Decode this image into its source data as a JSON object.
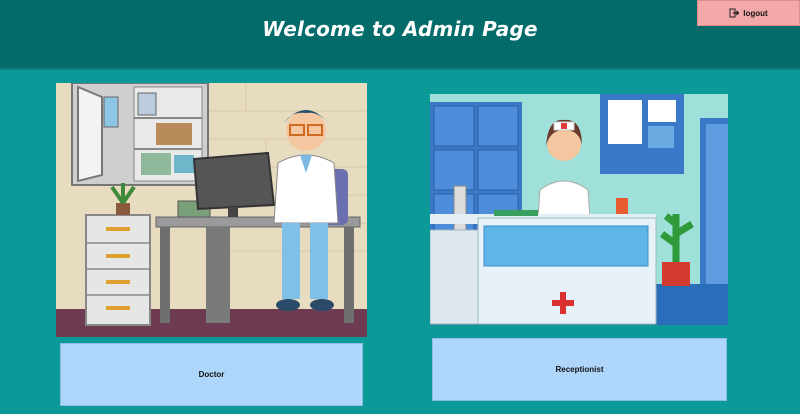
{
  "header": {
    "title": "Welcome  to Admin Page",
    "logout_label": "logout"
  },
  "cards": {
    "doctor": {
      "label": "Doctor",
      "image_icon": "doctor-illustration"
    },
    "receptionist": {
      "label": "Receptionist",
      "image_icon": "receptionist-illustration"
    }
  },
  "colors": {
    "background": "#0b9a97",
    "header": "#036b6a",
    "logout_button": "#f3a8aa",
    "card_button": "#aed6fb"
  }
}
